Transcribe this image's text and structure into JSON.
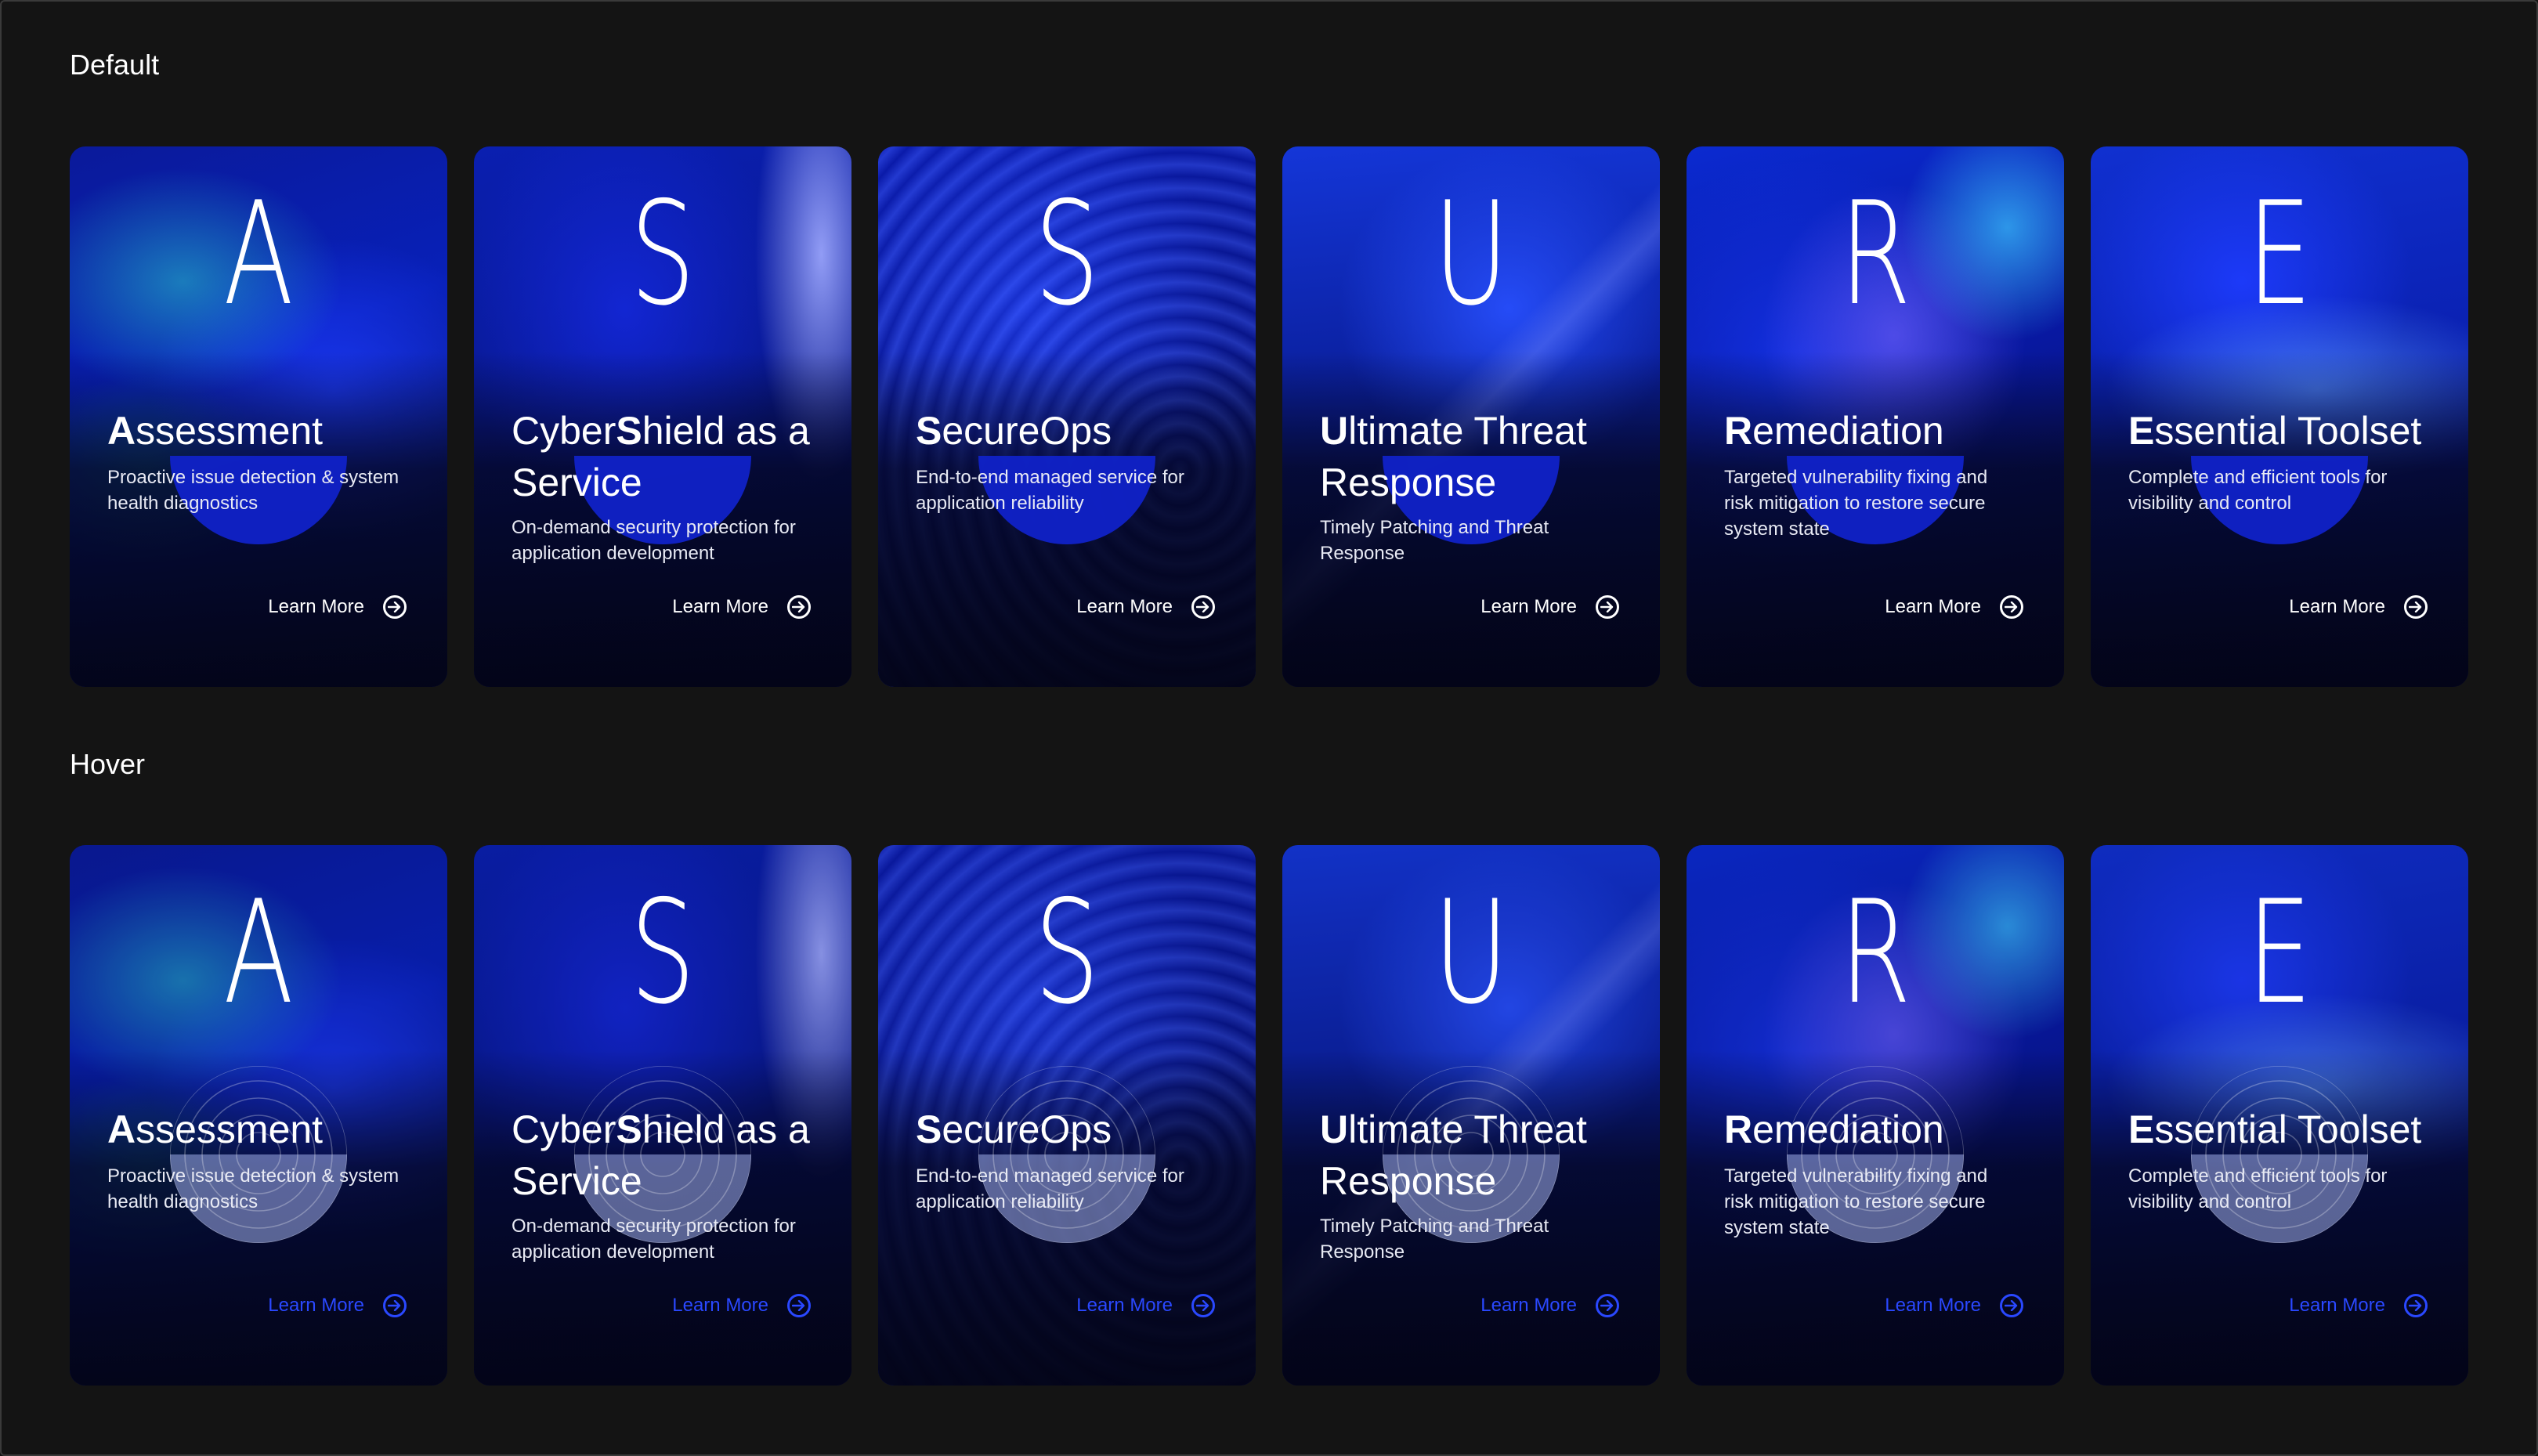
{
  "sections": {
    "default_label": "Default",
    "hover_label": "Hover"
  },
  "cards": [
    {
      "letter": "A",
      "title_bold": "A",
      "title_rest": "ssessment",
      "title_pre": "",
      "description": "Proactive issue detection & system health diagnostics",
      "cta": "Learn More"
    },
    {
      "letter": "S",
      "title_pre": "Cyber",
      "title_bold": "S",
      "title_rest": "hield as a Service",
      "description": "On-demand security protection for application development",
      "cta": "Learn More"
    },
    {
      "letter": "S",
      "title_pre": "",
      "title_bold": "S",
      "title_rest": "ecureOps",
      "description": "End-to-end managed service for application reliability",
      "cta": "Learn More"
    },
    {
      "letter": "U",
      "title_pre": "",
      "title_bold": "U",
      "title_rest": "ltimate Threat Response",
      "description": "Timely Patching and Threat Response",
      "cta": "Learn More"
    },
    {
      "letter": "R",
      "title_pre": "",
      "title_bold": "R",
      "title_rest": "emediation",
      "description": "Targeted vulnerability fixing and risk mitigation to restore secure system state",
      "cta": "Learn More"
    },
    {
      "letter": "E",
      "title_pre": "",
      "title_bold": "E",
      "title_rest": "ssential Toolset",
      "description": "Complete and efficient tools for visibility and control",
      "cta": "Learn More"
    }
  ],
  "icons": {
    "cta_icon": "arrow-right-circle-icon"
  },
  "colors": {
    "page_background": "#141414",
    "card_base": "#05083a",
    "orb_default": "#1022c8",
    "hover_link": "#2a48ff"
  }
}
